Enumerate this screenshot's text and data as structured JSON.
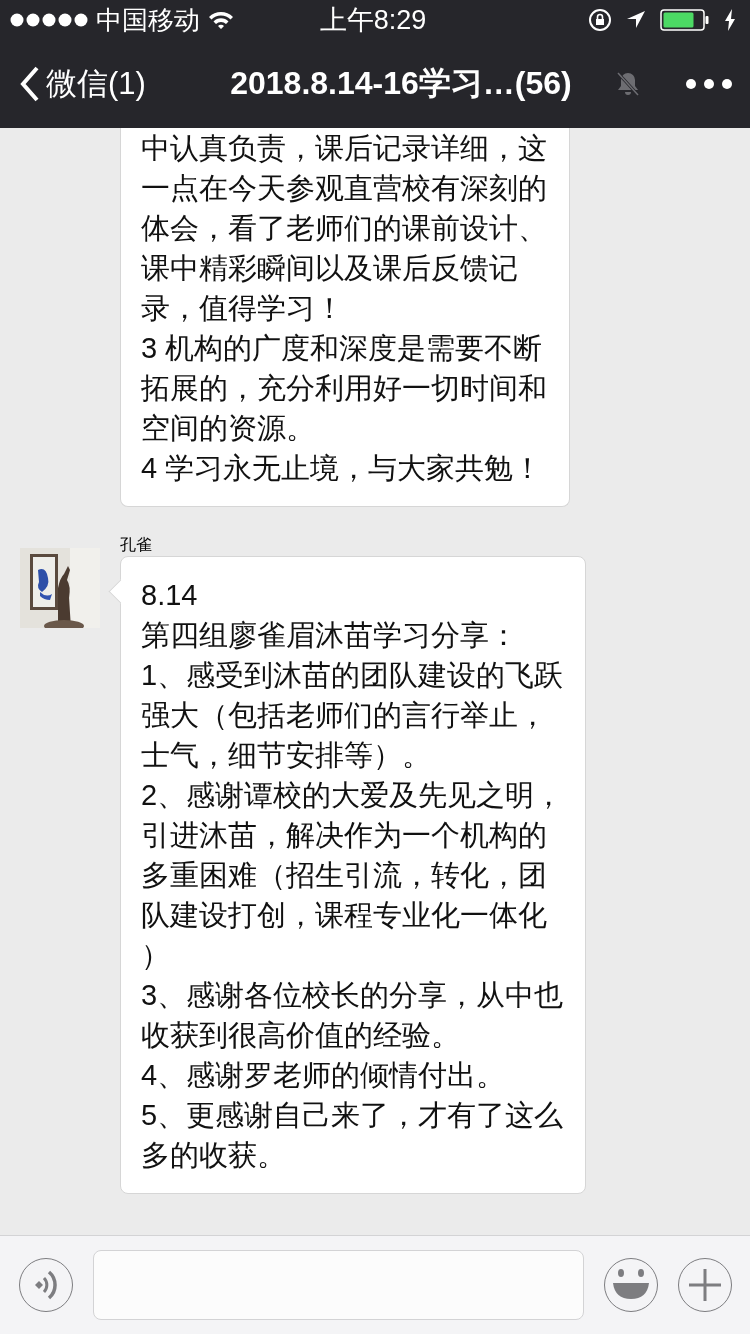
{
  "status_bar": {
    "carrier": "中国移动",
    "time": "上午8:29"
  },
  "nav": {
    "back_label": "微信(1)",
    "title": "2018.8.14-16学习…(56)",
    "muted": true
  },
  "messages": [
    {
      "kind": "continued",
      "lines": [
        "中认真负责，课后记录详细，这",
        "一点在今天参观直营校有深刻的",
        "体会，看了老师们的课前设计、",
        "课中精彩瞬间以及课后反馈记",
        "录，值得学习！",
        "3 机构的广度和深度是需要不断",
        "拓展的，充分利用好一切时间和",
        "空间的资源。",
        "4 学习永无止境，与大家共勉！"
      ]
    },
    {
      "kind": "full",
      "sender": "孔雀",
      "lines": [
        "8.14",
        "第四组廖雀眉沐苗学习分享：",
        "1、感受到沐苗的团队建设的飞跃",
        "强大（包括老师们的言行举止，",
        "士气，细节安排等）。",
        "2、感谢谭校的大爱及先见之明，",
        "引进沐苗，解决作为一个机构的",
        "多重困难（招生引流，转化，团",
        "队建设打创，课程专业化一体化",
        "）",
        "3、感谢各位校长的分享，从中也",
        "收获到很高价值的经验。",
        "4、感谢罗老师的倾情付出。",
        "5、更感谢自己来了，才有了这么",
        "多的收获。"
      ]
    }
  ]
}
